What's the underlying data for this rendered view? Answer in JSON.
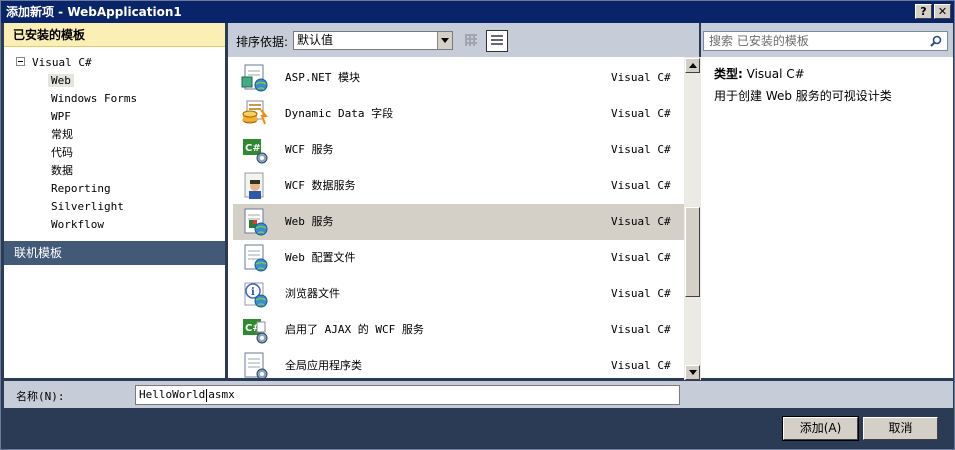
{
  "window": {
    "title": "添加新项 - WebApplication1",
    "help_btn": "?",
    "close_btn": "✕"
  },
  "left": {
    "installed_header": "已安装的模板",
    "tree": [
      {
        "label": "Visual C#",
        "level": 0
      },
      {
        "label": "Web",
        "level": 1,
        "selected": true
      },
      {
        "label": "Windows Forms",
        "level": 1
      },
      {
        "label": "WPF",
        "level": 1
      },
      {
        "label": "常规",
        "level": 1
      },
      {
        "label": "代码",
        "level": 1
      },
      {
        "label": "数据",
        "level": 1
      },
      {
        "label": "Reporting",
        "level": 1
      },
      {
        "label": "Silverlight",
        "level": 1
      },
      {
        "label": "Workflow",
        "level": 1
      }
    ],
    "online_header": "联机模板"
  },
  "sort": {
    "label": "排序依据:",
    "selected": "默认值"
  },
  "search": {
    "placeholder": "搜索 已安装的模板"
  },
  "items": [
    {
      "name": "ASP.NET 模块",
      "lang": "Visual C#",
      "icon": "aspnet-module-icon"
    },
    {
      "name": "Dynamic Data 字段",
      "lang": "Visual C#",
      "icon": "dynamic-data-icon"
    },
    {
      "name": "WCF 服务",
      "lang": "Visual C#",
      "icon": "wcf-service-icon"
    },
    {
      "name": "WCF 数据服务",
      "lang": "Visual C#",
      "icon": "wcf-data-service-icon"
    },
    {
      "name": "Web 服务",
      "lang": "Visual C#",
      "icon": "web-service-icon",
      "selected": true
    },
    {
      "name": "Web 配置文件",
      "lang": "Visual C#",
      "icon": "web-config-icon"
    },
    {
      "name": "浏览器文件",
      "lang": "Visual C#",
      "icon": "browser-file-icon"
    },
    {
      "name": "启用了 AJAX 的 WCF 服务",
      "lang": "Visual C#",
      "icon": "ajax-wcf-icon"
    },
    {
      "name": "全局应用程序类",
      "lang": "Visual C#",
      "icon": "global-app-class-icon"
    }
  ],
  "details": {
    "type_label": "类型:",
    "type_value": "Visual C#",
    "description": "用于创建 Web 服务的可视设计类"
  },
  "name_field": {
    "label": "名称(N):",
    "value_before_caret": "HelloWorld",
    "value_after_caret": "asmx"
  },
  "buttons": {
    "add": "添加(A)",
    "cancel": "取消"
  }
}
